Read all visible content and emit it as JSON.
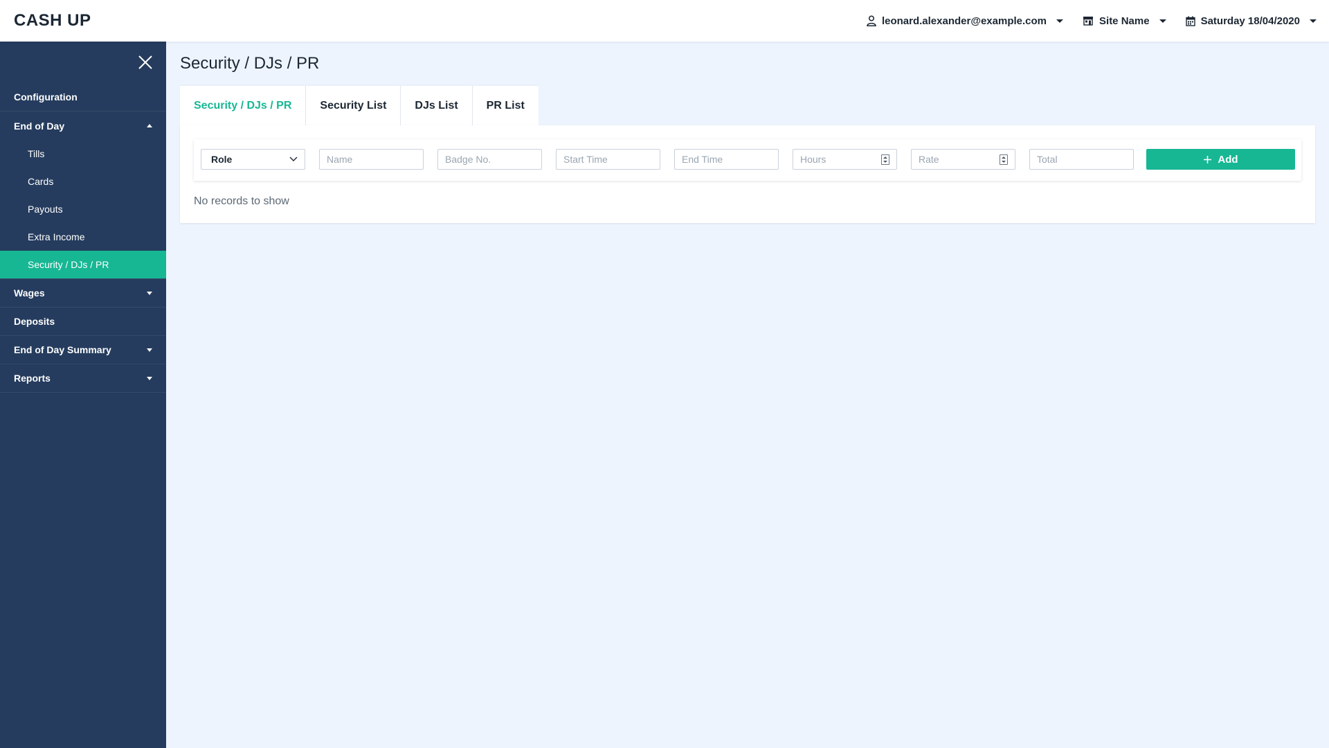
{
  "app": {
    "title": "CASH UP"
  },
  "header": {
    "user_email": "leonard.alexander@example.com",
    "site_name": "Site Name",
    "date": "Saturday 18/04/2020"
  },
  "sidebar": {
    "items": [
      {
        "label": "Configuration"
      },
      {
        "label": "End of Day",
        "expanded": true,
        "children": [
          {
            "label": "Tills"
          },
          {
            "label": "Cards"
          },
          {
            "label": "Payouts"
          },
          {
            "label": "Extra Income"
          },
          {
            "label": "Security / DJs / PR",
            "active": true
          }
        ]
      },
      {
        "label": "Wages"
      },
      {
        "label": "Deposits"
      },
      {
        "label": "End of Day Summary"
      },
      {
        "label": "Reports"
      }
    ]
  },
  "main": {
    "title": "Security / DJs / PR",
    "tabs": [
      {
        "label": "Security / DJs / PR",
        "active": true
      },
      {
        "label": "Security List"
      },
      {
        "label": "DJs List"
      },
      {
        "label": "PR List"
      }
    ],
    "form": {
      "role_value": "Role",
      "name_placeholder": "Name",
      "badge_placeholder": "Badge No.",
      "start_placeholder": "Start Time",
      "end_placeholder": "End Time",
      "hours_placeholder": "Hours",
      "rate_placeholder": "Rate",
      "total_placeholder": "Total",
      "add_label": "Add"
    },
    "empty_message": "No records to show"
  },
  "colors": {
    "accent": "#17b794",
    "sidebar": "#253c5e",
    "background": "#edf4fd"
  }
}
